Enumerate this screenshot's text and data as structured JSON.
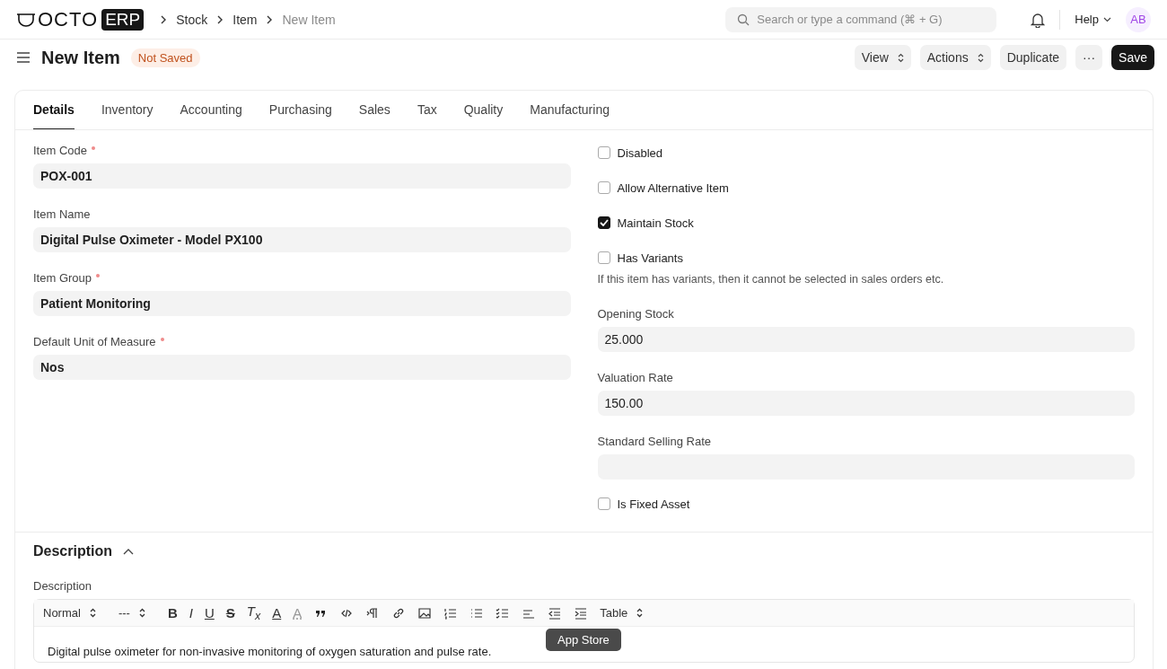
{
  "navbar": {
    "logo_text": "OCTO",
    "logo_badge": "ERP",
    "breadcrumbs": [
      {
        "label": "Stock",
        "current": false
      },
      {
        "label": "Item",
        "current": false
      },
      {
        "label": "New Item",
        "current": true
      }
    ],
    "search": {
      "placeholder": "Search or type a command (⌘ + G)"
    },
    "help": "Help",
    "avatar": "AB"
  },
  "page": {
    "title": "New Item",
    "status": "Not Saved",
    "buttons": [
      {
        "label": "View",
        "kind": "select"
      },
      {
        "label": "Actions",
        "kind": "select"
      },
      {
        "label": "Duplicate",
        "kind": "plain"
      },
      {
        "label": "···",
        "kind": "plain"
      },
      {
        "label": "Save",
        "kind": "primary"
      }
    ]
  },
  "tabs": [
    {
      "label": "Details",
      "selected": true
    },
    {
      "label": "Inventory",
      "selected": false
    },
    {
      "label": "Accounting",
      "selected": false
    },
    {
      "label": "Purchasing",
      "selected": false
    },
    {
      "label": "Sales",
      "selected": false
    },
    {
      "label": "Tax",
      "selected": false
    },
    {
      "label": "Quality",
      "selected": false
    },
    {
      "label": "Manufacturing",
      "selected": false
    }
  ],
  "left_fields": [
    {
      "label": "Item Code",
      "required": true,
      "value": "POX-001"
    },
    {
      "label": "Item Name",
      "required": false,
      "value": "Digital Pulse Oximeter - Model PX100"
    },
    {
      "label": "Item Group",
      "required": true,
      "value": "Patient Monitoring"
    },
    {
      "label": "Default Unit of Measure",
      "required": true,
      "value": "Nos"
    }
  ],
  "right_fields": [
    {
      "kind": "checkbox",
      "label": "Disabled",
      "checked": false
    },
    {
      "kind": "checkbox",
      "label": "Allow Alternative Item",
      "checked": false
    },
    {
      "kind": "checkbox",
      "label": "Maintain Stock",
      "checked": true
    },
    {
      "kind": "checkbox",
      "label": "Has Variants",
      "checked": false,
      "help": "If this item has variants, then it cannot be selected in sales orders etc."
    },
    {
      "kind": "input",
      "label": "Opening Stock",
      "value": "25.000"
    },
    {
      "kind": "input",
      "label": "Valuation Rate",
      "value": "150.00"
    },
    {
      "kind": "input",
      "label": "Standard Selling Rate"
    },
    {
      "kind": "checkbox",
      "label": "Is Fixed Asset",
      "checked": false
    }
  ],
  "description_section": {
    "title": "Description",
    "expanded": true,
    "field_label": "Description",
    "toolbar": [
      {
        "kind": "select",
        "label": "Normal"
      },
      {
        "kind": "select",
        "label": "---"
      },
      {
        "kind": "bold",
        "label": "B"
      },
      {
        "kind": "italic",
        "label": "I"
      },
      {
        "kind": "underline",
        "label": "U"
      },
      {
        "kind": "strike",
        "label": "S"
      },
      {
        "kind": "clear",
        "label": "T$_{x}$"
      },
      {
        "kind": "color",
        "label": "A"
      },
      {
        "kind": "highlight",
        "label": "A"
      },
      {
        "kind": "quote"
      },
      {
        "kind": "code"
      },
      {
        "kind": "pilcrow"
      },
      {
        "kind": "link"
      },
      {
        "kind": "image"
      },
      {
        "kind": "ordered"
      },
      {
        "kind": "bullet"
      },
      {
        "kind": "check"
      },
      {
        "kind": "align"
      },
      {
        "kind": "outdent"
      },
      {
        "kind": "indent"
      },
      {
        "kind": "select",
        "label": "Table"
      }
    ],
    "content": "Digital pulse oximeter for non-invasive monitoring of oxygen saturation and pulse rate.",
    "tooltip": "App Store"
  }
}
